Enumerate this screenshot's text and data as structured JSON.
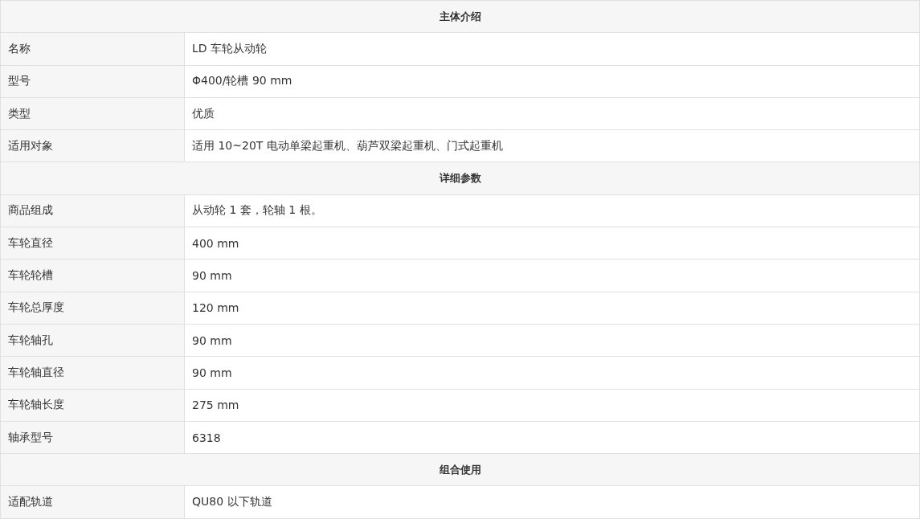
{
  "sections": [
    {
      "title": "主体介绍",
      "rows": [
        {
          "label": "名称",
          "value": "LD 车轮从动轮"
        },
        {
          "label": "型号",
          "value": "Φ400/轮槽 90 mm"
        },
        {
          "label": "类型",
          "value": "优质"
        },
        {
          "label": "适用对象",
          "value": "适用 10~20T 电动单梁起重机、葫芦双梁起重机、门式起重机"
        }
      ]
    },
    {
      "title": "详细参数",
      "rows": [
        {
          "label": "商品组成",
          "value": "从动轮 1 套，轮轴 1 根。"
        },
        {
          "label": "车轮直径",
          "value": "400 mm"
        },
        {
          "label": "车轮轮槽",
          "value": "90 mm"
        },
        {
          "label": "车轮总厚度",
          "value": "120 mm"
        },
        {
          "label": "车轮轴孔",
          "value": "90 mm"
        },
        {
          "label": "车轮轴直径",
          "value": "90 mm"
        },
        {
          "label": "车轮轴长度",
          "value": "275 mm"
        },
        {
          "label": "轴承型号",
          "value": "6318"
        }
      ]
    },
    {
      "title": "组合使用",
      "rows": [
        {
          "label": "适配轨道",
          "value": "QU80 以下轨道"
        }
      ]
    }
  ]
}
